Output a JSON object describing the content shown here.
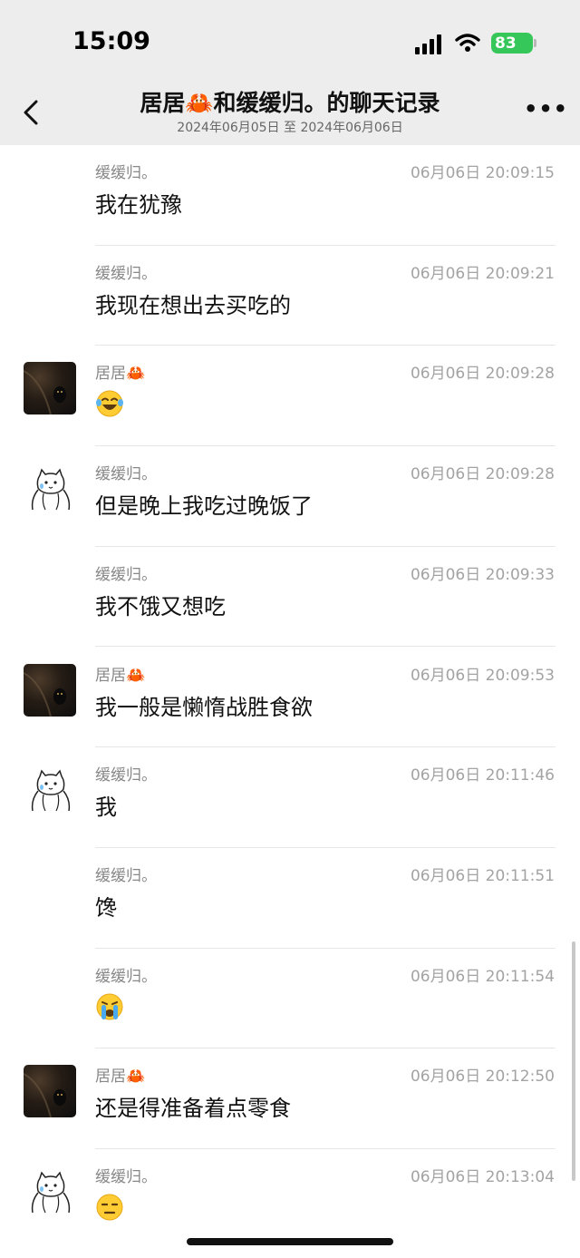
{
  "status": {
    "time": "15:09",
    "battery": "83"
  },
  "nav": {
    "title": "居居🦀和缓缓归。的聊天记录",
    "subtitle": "2024年06月05日 至 2024年06月06日"
  },
  "messages": [
    {
      "sender": "缓缓归。",
      "time": "06月06日 20:09:15",
      "text": "我在犹豫",
      "avatar": "none"
    },
    {
      "sender": "缓缓归。",
      "time": "06月06日 20:09:21",
      "text": "我现在想出去买吃的",
      "avatar": "none"
    },
    {
      "sender": "居居🦀",
      "time": "06月06日 20:09:28",
      "text": "",
      "emoji": "laughing-tears-emoji",
      "avatar": "dark-photo"
    },
    {
      "sender": "缓缓归。",
      "time": "06月06日 20:09:28",
      "text": "但是晚上我吃过晚饭了",
      "avatar": "cat-sketch"
    },
    {
      "sender": "缓缓归。",
      "time": "06月06日 20:09:33",
      "text": "我不饿又想吃",
      "avatar": "none"
    },
    {
      "sender": "居居🦀",
      "time": "06月06日 20:09:53",
      "text": "我一般是懒惰战胜食欲",
      "avatar": "dark-photo"
    },
    {
      "sender": "缓缓归。",
      "time": "06月06日 20:11:46",
      "text": "我",
      "avatar": "cat-sketch"
    },
    {
      "sender": "缓缓归。",
      "time": "06月06日 20:11:51",
      "text": "馋",
      "avatar": "none"
    },
    {
      "sender": "缓缓归。",
      "time": "06月06日 20:11:54",
      "text": "",
      "emoji": "crying-emoji",
      "avatar": "none"
    },
    {
      "sender": "居居🦀",
      "time": "06月06日 20:12:50",
      "text": "还是得准备着点零食",
      "avatar": "dark-photo"
    },
    {
      "sender": "缓缓归。",
      "time": "06月06日 20:13:04",
      "text": "",
      "emoji": "expressionless-emoji",
      "avatar": "cat-sketch"
    }
  ]
}
